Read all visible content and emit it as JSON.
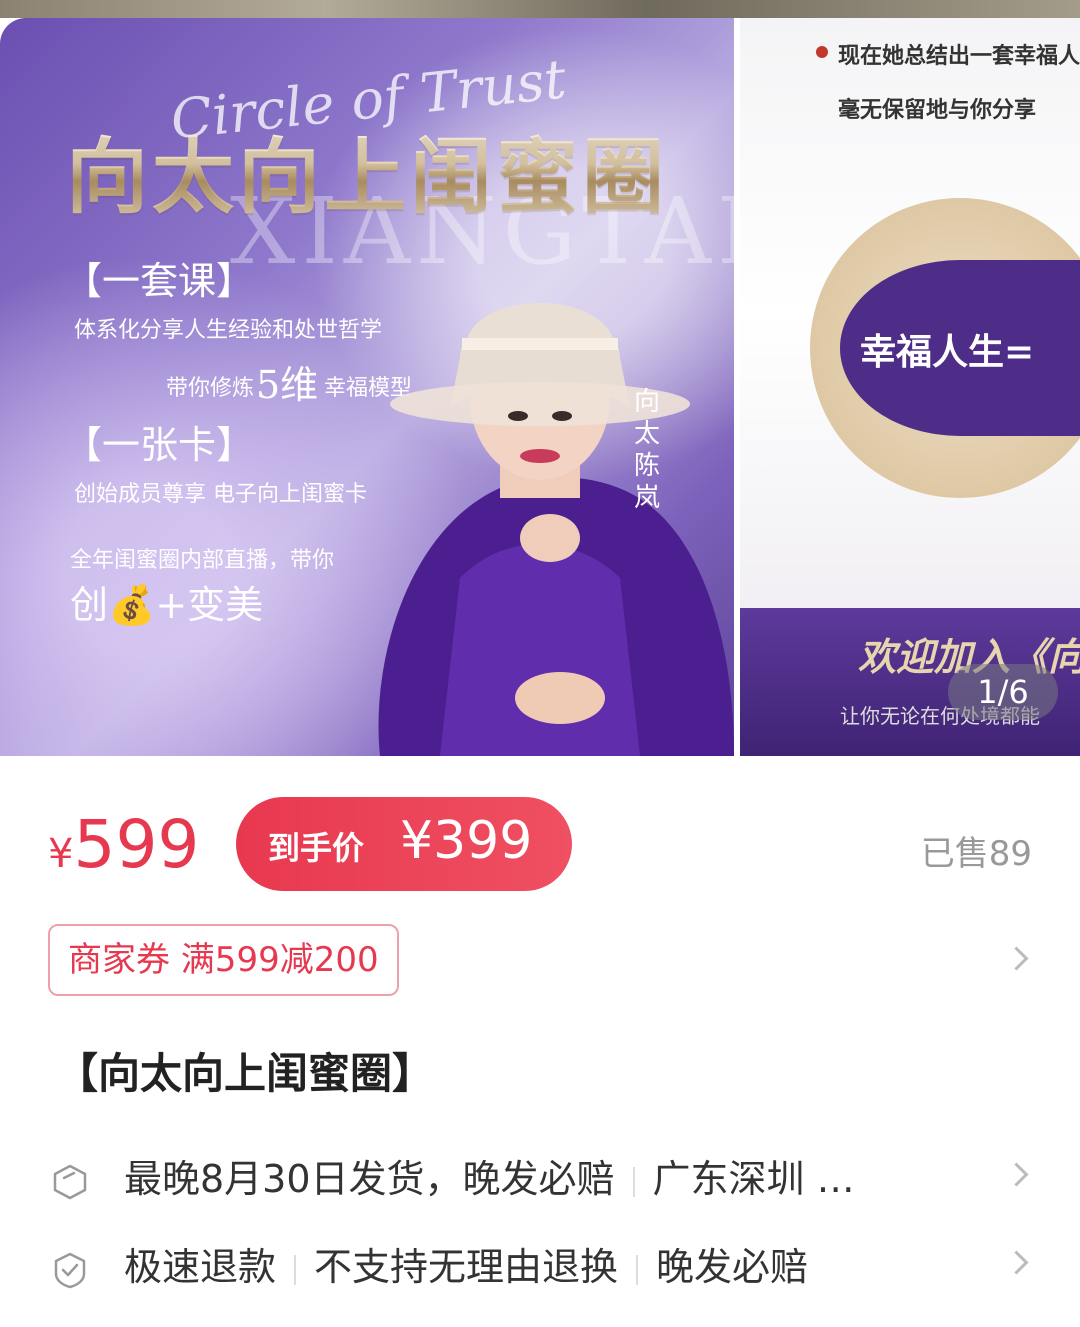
{
  "carousel": {
    "main_slide": {
      "script_text": "Circle of Trust",
      "title": "向太向上闺蜜圈",
      "ghost_text": "XIANGTAI",
      "section1_title": "【一套课】",
      "section1_line1": "体系化分享人生经验和处世哲学",
      "section1_line2_pre": "带你修炼",
      "section1_line2_big": "5维",
      "section1_line2_post": "幸福模型",
      "section2_title": "【一张卡】",
      "section2_line": "创始成员尊享 电子向上闺蜜卡",
      "section3_line": "全年闺蜜圈内部直播，带你",
      "section3_big": "创💰+变美",
      "vertical_name": "向太陈岚"
    },
    "next_slide": {
      "line1": "现在她总结出一套幸福人",
      "line2": "毫无保留地与你分享",
      "circle_text": "幸福人生=",
      "banner_title": "欢迎加入《向",
      "banner_sub": "让你无论在何处境都能"
    },
    "pager": "1/6"
  },
  "price": {
    "currency": "¥",
    "value": "599",
    "deal_label": "到手价",
    "deal_value": "¥399",
    "sold": "已售89"
  },
  "coupon": {
    "label": "商家券 满599减200"
  },
  "product_title": "【向太向上闺蜜圈】",
  "shipping": {
    "icon": "shipping-box-icon",
    "text": "最晚8月30日发货，晚发必赔",
    "location": "广东深圳 …"
  },
  "service": {
    "icon": "shield-check-icon",
    "items": [
      "极速退款",
      "不支持无理由退换",
      "晚发必赔"
    ]
  }
}
